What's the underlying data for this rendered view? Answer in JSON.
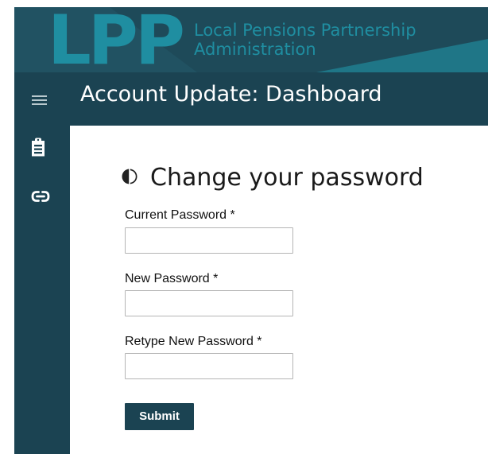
{
  "brand": {
    "logo_letters": "LPP",
    "org_line1": "Local Pensions Partnership",
    "org_line2": "Administration",
    "primary_color": "#1b4352",
    "accent_color": "#1f8ea1"
  },
  "header": {
    "title": "Account Update: Dashboard",
    "menu_icon": "hamburger-menu-icon"
  },
  "sidebar": {
    "items": [
      {
        "icon": "clipboard-icon"
      },
      {
        "icon": "link-icon"
      }
    ]
  },
  "main": {
    "heading": "Change your password",
    "heading_icon": "contrast-circle-icon",
    "fields": [
      {
        "label": "Current Password *",
        "value": "",
        "placeholder": ""
      },
      {
        "label": "New Password *",
        "value": "",
        "placeholder": ""
      },
      {
        "label": "Retype New Password *",
        "value": "",
        "placeholder": ""
      }
    ],
    "submit_label": "Submit"
  }
}
